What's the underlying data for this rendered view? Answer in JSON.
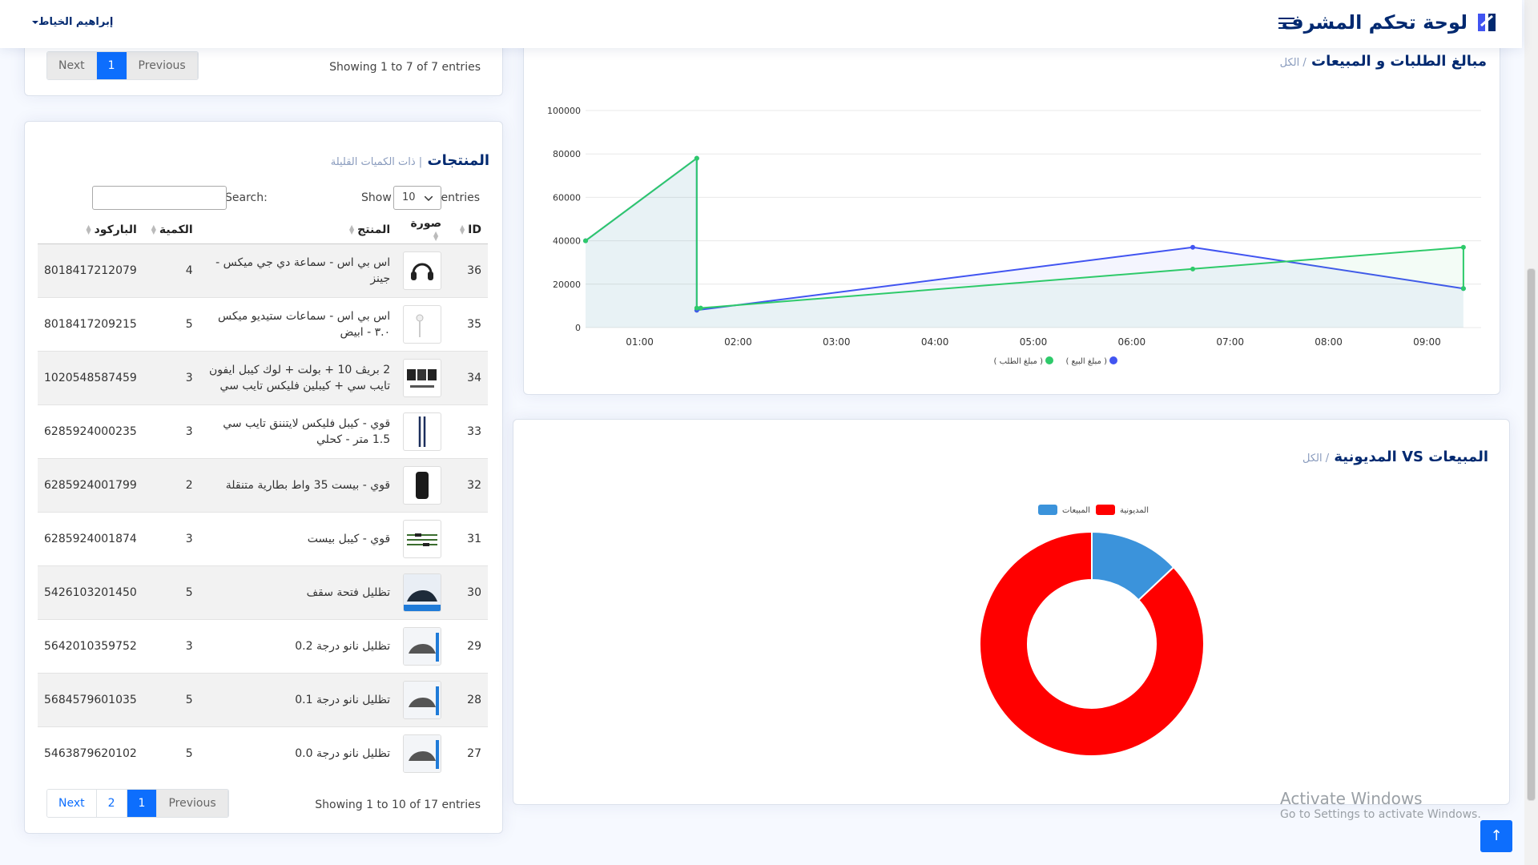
{
  "header": {
    "title": "لوحة تحكم المشرف",
    "user_name": "إبراهيم الخياط"
  },
  "top_table": {
    "info": "Showing 1 to 7 of 7 entries",
    "pagination": [
      "Previous",
      "1",
      "Next"
    ]
  },
  "products": {
    "title": "المنتجات",
    "subtitle": "| ذات الكميات القليلة",
    "show_label": "Show",
    "page_size": "10",
    "entries_label": "entries",
    "search_label": "Search:",
    "columns": [
      "ID",
      "صورة",
      "المنتج",
      "الكمية",
      "الباركود"
    ],
    "rows": [
      {
        "id": "36",
        "image": "headphones",
        "name": "اس بي اس - سماعة دي جي ميكس - جينز",
        "qty": "4",
        "barcode": "8018417212079"
      },
      {
        "id": "35",
        "image": "earphones",
        "name": "اس بي اس - سماعات ستيديو ميكس ٣.٠ - ابيض",
        "qty": "5",
        "barcode": "8018417209215"
      },
      {
        "id": "34",
        "image": "bundle",
        "name": "2 بريڤ 10 + بولت + لوك كيبل ايفون تايب سي + كيبلين فليكس تايب سي",
        "qty": "3",
        "barcode": "1020548587459"
      },
      {
        "id": "33",
        "image": "cable",
        "name": "قوي - كيبل فليكس لايتننق تايب سي 1.5 متر - كحلي",
        "qty": "3",
        "barcode": "6285924000235"
      },
      {
        "id": "32",
        "image": "powerbank",
        "name": "قوي - بيست 35 واط بطارية متنقلة",
        "qty": "2",
        "barcode": "6285924001799"
      },
      {
        "id": "31",
        "image": "cables",
        "name": "قوي - كيبل بيست",
        "qty": "3",
        "barcode": "6285924001874"
      },
      {
        "id": "30",
        "image": "car-roof",
        "name": "تظليل فتحة سقف",
        "qty": "5",
        "barcode": "5426103201450"
      },
      {
        "id": "29",
        "image": "car-tint",
        "name": "تظليل نانو درجة 0.2",
        "qty": "3",
        "barcode": "5642010359752"
      },
      {
        "id": "28",
        "image": "car-tint",
        "name": "تظليل نانو درجة 0.1",
        "qty": "5",
        "barcode": "5684579601035"
      },
      {
        "id": "27",
        "image": "car-tint",
        "name": "تظليل نانو درجة 0.0",
        "qty": "5",
        "barcode": "5463879620102"
      }
    ],
    "info": "Showing 1 to 10 of 17 entries",
    "pagination": [
      "Previous",
      "1",
      "2",
      "Next"
    ]
  },
  "orders_chart": {
    "title": "مبالغ الطلبات و المبيعات",
    "subtitle": "/ الكل",
    "legend": [
      "( مبلغ البيع )",
      "( مبلغ الطلب )"
    ],
    "colors": {
      "sales": "#4154f1",
      "orders": "#2eca6a"
    }
  },
  "donut_chart": {
    "title": "المبيعات VS المديونية",
    "subtitle": "/ الكل",
    "legend": [
      "المديونية",
      "المبيعات"
    ],
    "colors": {
      "debt": "#ff0000",
      "sales": "#3b93db"
    }
  },
  "chart_data": [
    {
      "type": "area",
      "x": [
        "01:00",
        "02:00",
        "03:00",
        "04:00",
        "05:00",
        "06:00",
        "07:00",
        "08:00",
        "09:00"
      ],
      "y_ticks": [
        "0",
        "20000",
        "40000",
        "60000",
        "80000",
        "100000"
      ],
      "ylim": [
        0,
        100000
      ],
      "series": [
        {
          "name": "( مبلغ البيع )",
          "points": [
            [
              0.45,
              40000
            ],
            [
              1.58,
              78000
            ],
            [
              1.58,
              8000
            ],
            [
              6.62,
              37000
            ],
            [
              9.37,
              18000
            ]
          ]
        },
        {
          "name": "( مبلغ الطلب )",
          "points": [
            [
              0.45,
              40000
            ],
            [
              1.58,
              78000
            ],
            [
              1.58,
              9000
            ],
            [
              1.62,
              9000
            ],
            [
              6.62,
              27000
            ],
            [
              9.37,
              37000
            ],
            [
              9.37,
              18000
            ]
          ]
        }
      ]
    },
    {
      "type": "pie",
      "labels": [
        "المديونية",
        "المبيعات"
      ],
      "values": [
        87,
        13
      ]
    }
  ],
  "watermark": {
    "line1": "Activate Windows",
    "line2": "Go to Settings to activate Windows."
  },
  "scroll_top": "↑"
}
